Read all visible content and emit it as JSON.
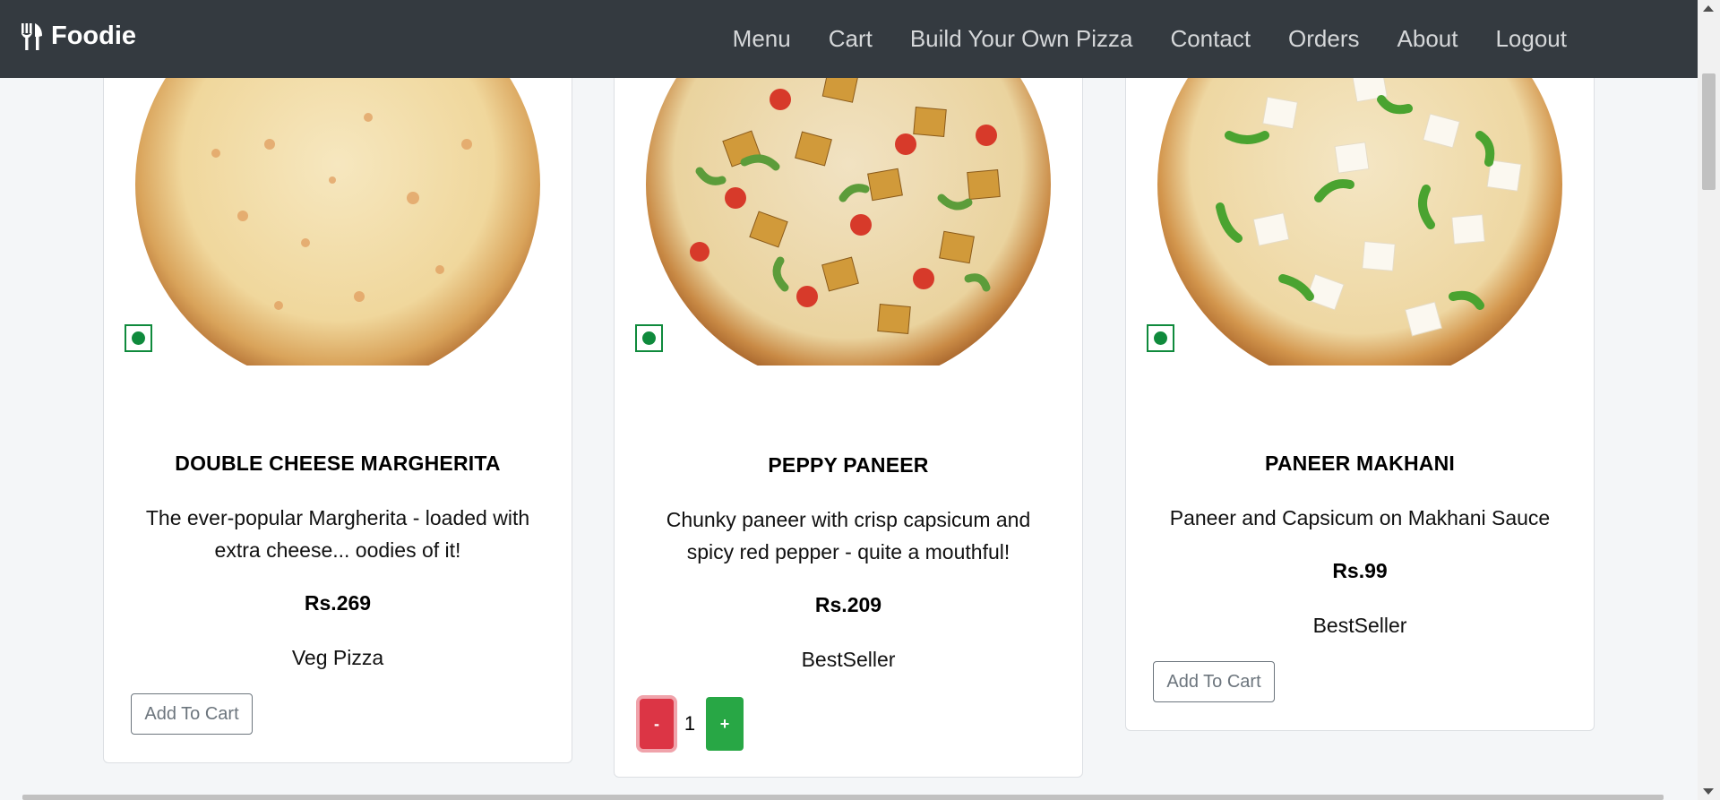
{
  "brand": {
    "name": "Foodie",
    "icon": "fork-knife-icon"
  },
  "nav": {
    "items": [
      "Menu",
      "Cart",
      "Build Your Own Pizza",
      "Contact",
      "Orders",
      "About",
      "Logout"
    ]
  },
  "colors": {
    "navbar": "#343a40",
    "veg_green": "#0f8a3c",
    "minus_red": "#dc3545",
    "plus_green": "#28a745"
  },
  "products": [
    {
      "name": "DOUBLE CHEESE MARGHERITA",
      "description": "The ever-popular Margherita - loaded with extra cheese... oodies of it!",
      "price": "Rs.269",
      "category": "Veg Pizza",
      "action": "Add To Cart"
    },
    {
      "name": "PEPPY PANEER",
      "description": "Chunky paneer with crisp capsicum and spicy red pepper - quite a mouthful!",
      "price": "Rs.209",
      "category": "BestSeller",
      "quantity": {
        "minus": "-",
        "value": "1",
        "plus": "+"
      }
    },
    {
      "name": "PANEER MAKHANI",
      "description": "Paneer and Capsicum on Makhani Sauce",
      "price": "Rs.99",
      "category": "BestSeller",
      "action": "Add To Cart"
    }
  ]
}
